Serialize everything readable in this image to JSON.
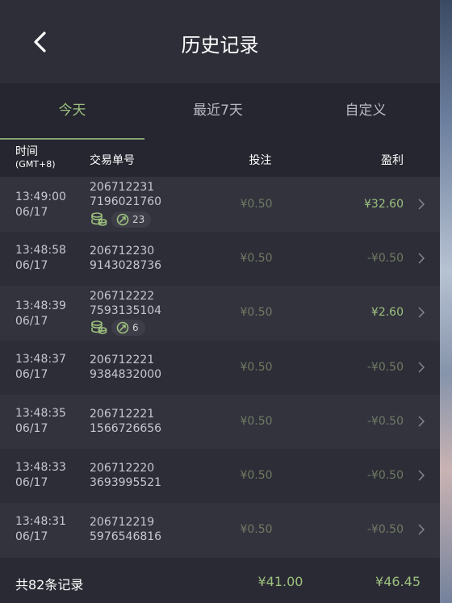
{
  "header": {
    "title": "历史记录",
    "back_icon": "chevron-left-icon"
  },
  "tabs": [
    {
      "label": "今天",
      "active": true
    },
    {
      "label": "最近7天",
      "active": false
    },
    {
      "label": "自定义",
      "active": false
    }
  ],
  "columns": {
    "time": "时间",
    "time_zone": "(GMT+8)",
    "order": "交易单号",
    "bet": "投注",
    "profit": "盈利"
  },
  "rows": [
    {
      "time": "13:49:00",
      "date": "06/17",
      "order_line1": "206712231",
      "order_line2": "7196021760",
      "bet": "¥0.50",
      "profit": "¥32.60",
      "profit_positive": true,
      "badge_count": "23"
    },
    {
      "time": "13:48:58",
      "date": "06/17",
      "order_line1": "206712230",
      "order_line2": "9143028736",
      "bet": "¥0.50",
      "profit": "-¥0.50",
      "profit_positive": false
    },
    {
      "time": "13:48:39",
      "date": "06/17",
      "order_line1": "206712222",
      "order_line2": "7593135104",
      "bet": "¥0.50",
      "profit": "¥2.60",
      "profit_positive": true,
      "badge_count": "6"
    },
    {
      "time": "13:48:37",
      "date": "06/17",
      "order_line1": "206712221",
      "order_line2": "9384832000",
      "bet": "¥0.50",
      "profit": "-¥0.50",
      "profit_positive": false
    },
    {
      "time": "13:48:35",
      "date": "06/17",
      "order_line1": "206712221",
      "order_line2": "1566726656",
      "bet": "¥0.50",
      "profit": "-¥0.50",
      "profit_positive": false
    },
    {
      "time": "13:48:33",
      "date": "06/17",
      "order_line1": "206712220",
      "order_line2": "3693995521",
      "bet": "¥0.50",
      "profit": "-¥0.50",
      "profit_positive": false
    },
    {
      "time": "13:48:31",
      "date": "06/17",
      "order_line1": "206712219",
      "order_line2": "5976546816",
      "bet": "¥0.50",
      "profit": "-¥0.50",
      "profit_positive": false
    }
  ],
  "footer": {
    "count_label": "共82条记录",
    "total_bet": "¥41.00",
    "total_profit": "¥46.45"
  },
  "colors": {
    "accent_green": "#9cc17e",
    "muted_green": "#6f7a62",
    "background": "#30303b"
  }
}
